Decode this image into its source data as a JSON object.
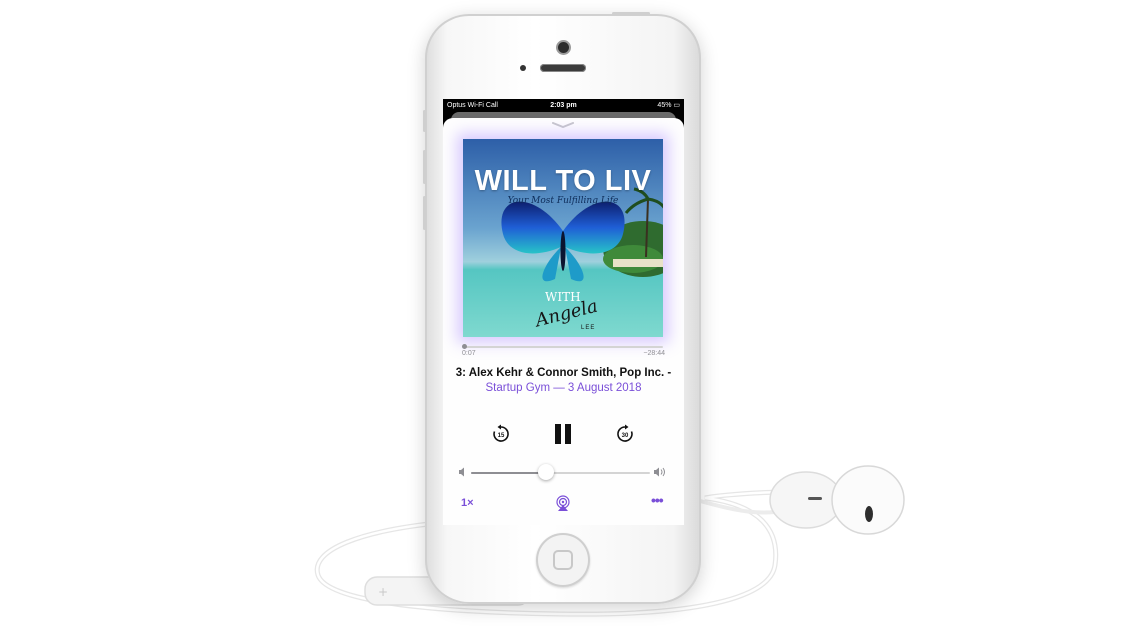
{
  "status_bar": {
    "carrier": "Optus Wi-Fi Call",
    "time": "2:03 pm",
    "battery": "45%"
  },
  "artwork": {
    "title": "WILL TO LIV",
    "subtitle": "Your Most Fulfilling Life",
    "with": "WITH",
    "signature": "Angela",
    "surname": "LEE"
  },
  "playback": {
    "elapsed": "0:07",
    "remaining": "−28:44",
    "progress": 0.004,
    "volume": 0.42
  },
  "episode": {
    "title": "3: Alex Kehr & Connor Smith, Pop Inc. -",
    "subtitle": "Startup Gym — 3 August 2018"
  },
  "controls": {
    "skip_back_seconds": "15",
    "skip_forward_seconds": "30",
    "speed": "1×"
  },
  "colors": {
    "accent": "#7a4fd8"
  },
  "icons": [
    "chevron-down-icon",
    "skip-back-15-icon",
    "pause-icon",
    "skip-forward-30-icon",
    "volume-low-icon",
    "volume-high-icon",
    "airplay-icon",
    "more-icon"
  ]
}
